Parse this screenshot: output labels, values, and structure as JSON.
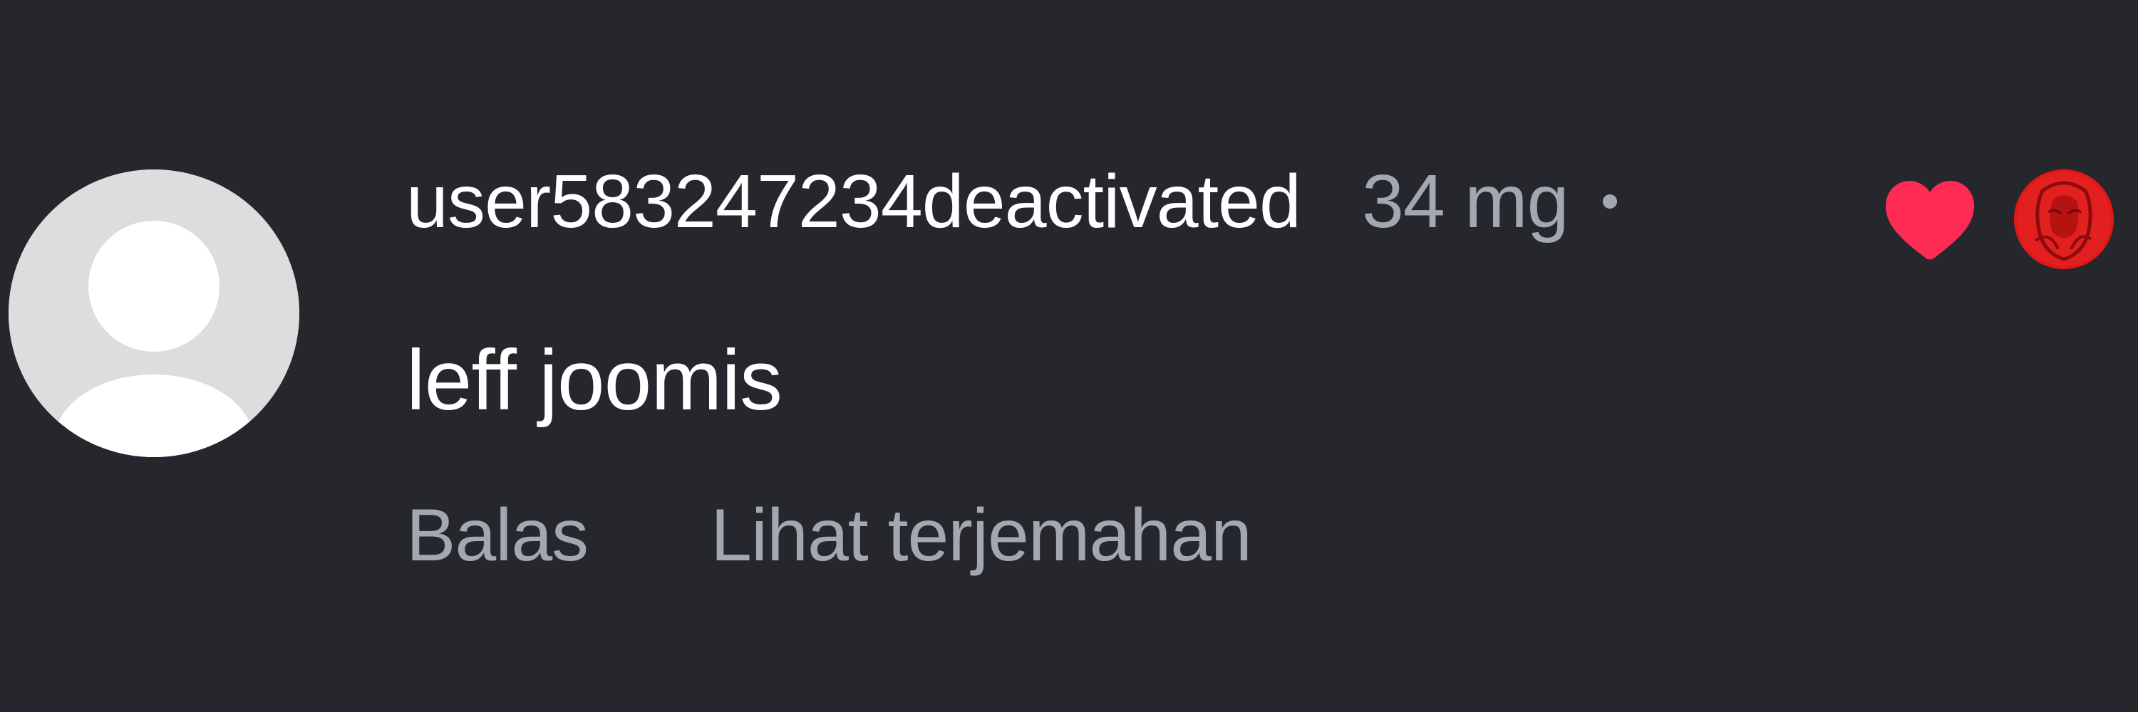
{
  "comment": {
    "username": "user583247234deactivated",
    "timestamp": "34 mg",
    "text": "leff joomis",
    "actions": {
      "reply_label": "Balas",
      "translate_label": "Lihat terjemahan"
    },
    "liked_by_creator": true
  },
  "icons": {
    "avatar": "default-user-avatar-icon",
    "heart": "heart-icon",
    "creator_avatar": "creator-avatar"
  },
  "colors": {
    "background": "#25272d",
    "text_primary": "#ffffff",
    "text_secondary": "#a3a7b1",
    "heart": "#fe2c55",
    "avatar_placeholder": "#dddddd"
  }
}
